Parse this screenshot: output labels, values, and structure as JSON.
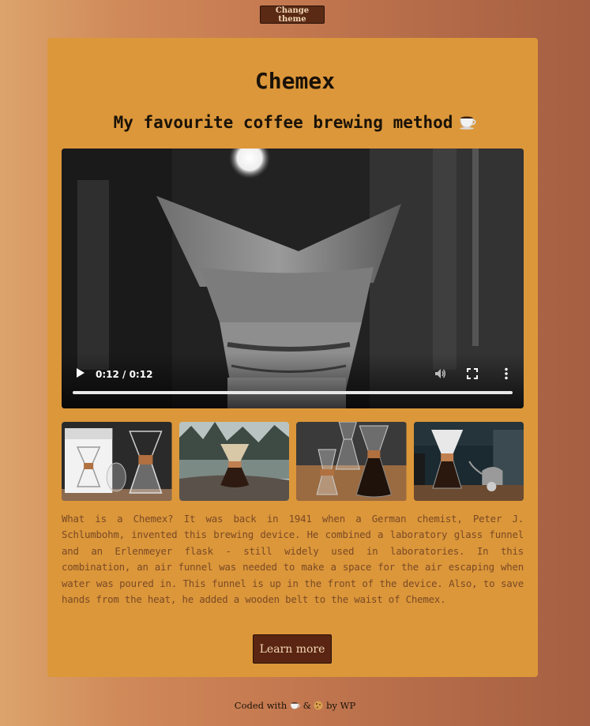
{
  "header": {
    "change_theme_label": "Change theme"
  },
  "card": {
    "title": "Chemex",
    "subtitle": "My favourite coffee brewing method",
    "subtitle_icon": "coffee-cup-icon"
  },
  "video": {
    "time_display": "0:12 / 0:12",
    "progress": 1.0,
    "controls": [
      "play-icon",
      "volume-icon",
      "fullscreen-icon",
      "more-options-icon"
    ]
  },
  "gallery": {
    "images": [
      "chemex-box-and-carafe",
      "chemex-on-rock-by-lake",
      "chemex-carafes-on-table",
      "barista-pouring-chemex"
    ]
  },
  "description": "What is a Chemex? It was back in 1941 when a German chemist, Peter J. Schlumbohm, invented this brewing device. He combined a laboratory glass funnel and an Erlenmeyer flask - still widely used in laboratories. In this combination, an air funnel was needed to make a space for the air escaping when water was poured in. This funnel is up in the front of the device. Also, to save hands from the heat, he added a wooden belt to the waist of Chemex.",
  "learn_more_label": "Learn more",
  "footer": {
    "prefix": "Coded with",
    "icon_1": "coffee-cup-icon",
    "ampersand": "&",
    "icon_2": "cookie-icon",
    "suffix": "by WP"
  },
  "colors": {
    "card_background": "#dc973a",
    "button_background": "#5a2512",
    "button_text": "#f4d7b5",
    "description_text": "#7a4a26"
  }
}
